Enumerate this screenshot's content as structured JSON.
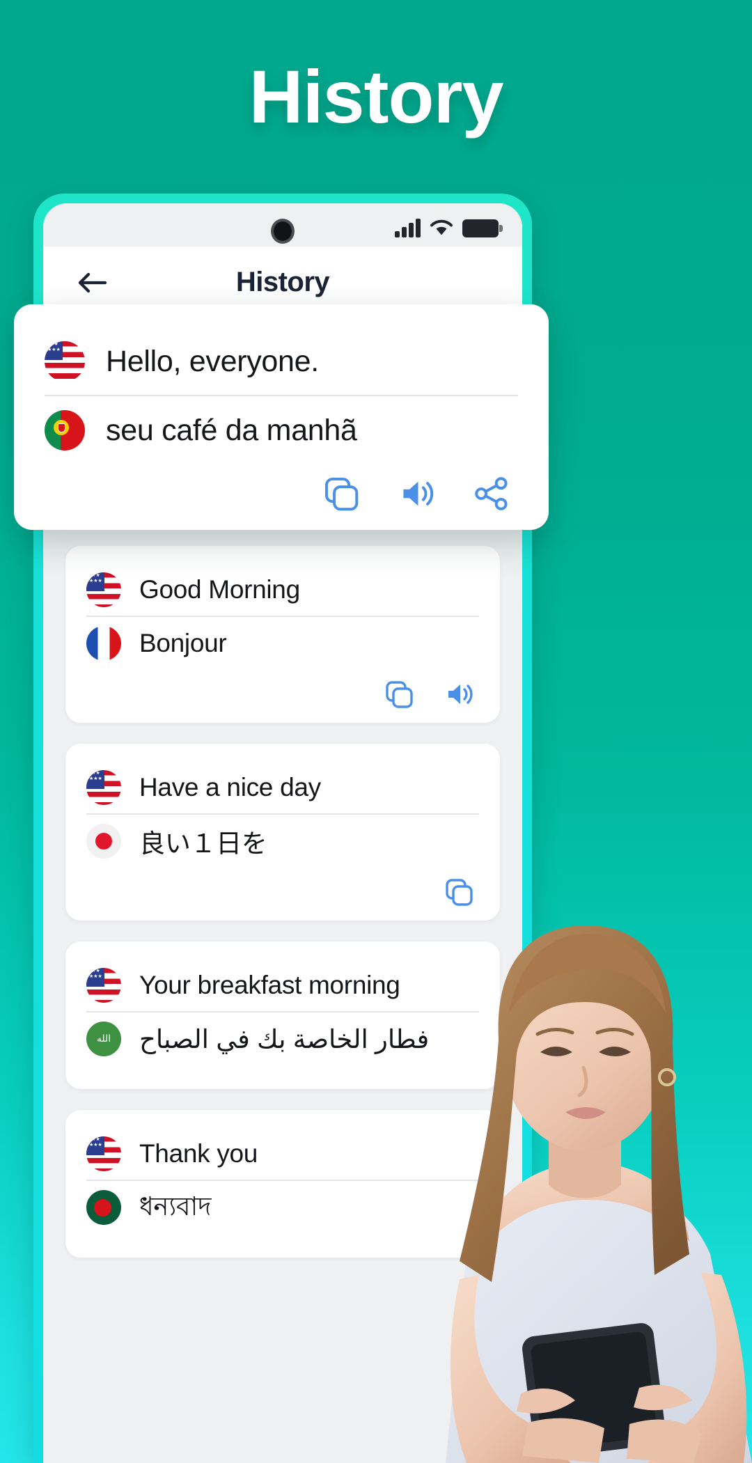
{
  "hero": {
    "title": "History"
  },
  "phone": {
    "status_bar": {
      "signal_icon": "signal-bars-icon",
      "wifi_icon": "wifi-icon",
      "battery_icon": "battery-icon"
    },
    "nav": {
      "back_icon": "back-arrow-icon",
      "title": "History"
    }
  },
  "highlight_card": {
    "source": {
      "flag": "flag-us",
      "flag_label": "United States",
      "text": "Hello, everyone."
    },
    "target": {
      "flag": "flag-pt",
      "flag_label": "Portugal",
      "text": "seu café da manhã"
    },
    "actions": [
      {
        "name": "copy-icon",
        "label": "Copy"
      },
      {
        "name": "speaker-icon",
        "label": "Listen"
      },
      {
        "name": "share-icon",
        "label": "Share"
      }
    ]
  },
  "history_items": [
    {
      "source": {
        "flag": "flag-us",
        "flag_label": "United States",
        "text": "Good Morning"
      },
      "target": {
        "flag": "flag-fr",
        "flag_label": "France",
        "text": "Bonjour"
      },
      "actions": [
        {
          "name": "copy-icon",
          "label": "Copy"
        },
        {
          "name": "speaker-icon",
          "label": "Listen"
        }
      ]
    },
    {
      "source": {
        "flag": "flag-us",
        "flag_label": "United States",
        "text": "Have a nice day"
      },
      "target": {
        "flag": "flag-jp",
        "flag_label": "Japan",
        "text": "良い１日を"
      },
      "actions": [
        {
          "name": "copy-icon",
          "label": "Copy"
        }
      ]
    },
    {
      "source": {
        "flag": "flag-us",
        "flag_label": "United States",
        "text": "Your breakfast morning"
      },
      "target": {
        "flag": "flag-sa",
        "flag_label": "Saudi Arabia",
        "text": "فطار الخاصة بك في الصباح"
      },
      "actions": []
    },
    {
      "source": {
        "flag": "flag-us",
        "flag_label": "United States",
        "text": "Thank you"
      },
      "target": {
        "flag": "flag-bd",
        "flag_label": "Bangladesh",
        "text": "ধন্যবাদ"
      },
      "actions": []
    }
  ],
  "colors": {
    "background_top": "#00a88e",
    "background_bottom": "#23e6ea",
    "phone_frame": "#16e0d4",
    "accent_blue": "#4a90e8",
    "nav_title": "#1b2336",
    "card_bg": "#ffffff",
    "list_bg": "#eef0f2"
  }
}
